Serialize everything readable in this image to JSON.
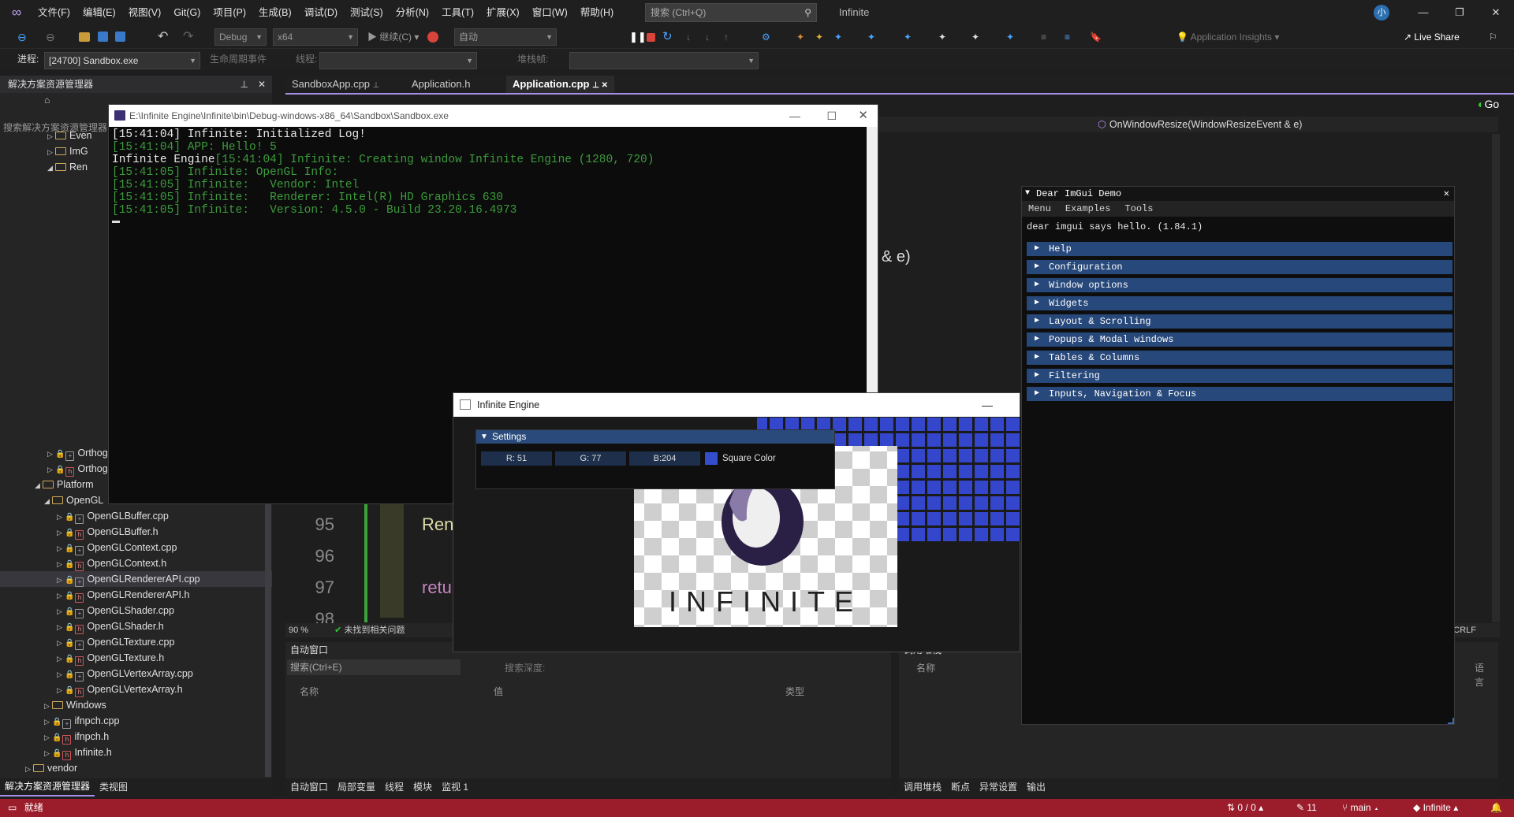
{
  "menu": [
    "文件(F)",
    "编辑(E)",
    "视图(V)",
    "Git(G)",
    "项目(P)",
    "生成(B)",
    "调试(D)",
    "测试(S)",
    "分析(N)",
    "工具(T)",
    "扩展(X)",
    "窗口(W)",
    "帮助(H)"
  ],
  "search": {
    "placeholder": "搜索 (Ctrl+Q)"
  },
  "solution_name": "Infinite",
  "account_initials": "小",
  "toolbar": {
    "config": "Debug",
    "platform": "x64",
    "continue": "继续(C)",
    "auto": "自动",
    "insights": "Application Insights",
    "live_share": "Live Share"
  },
  "toolbar2": {
    "process_label": "进程:",
    "process": "[24700] Sandbox.exe",
    "lifecycle": "生命周期事件",
    "thread_label": "线程:",
    "stack_label": "堆栈帧:"
  },
  "sol_explorer": {
    "title": "解决方案资源管理器",
    "search": "搜索解决方案资源管理器",
    "items": [
      {
        "label": "Even",
        "indent": 1
      },
      {
        "label": "ImG",
        "indent": 1
      },
      {
        "label": "Ren",
        "indent": 1
      },
      {
        "label": "OrthographicCamera.cpp",
        "indent": 1
      },
      {
        "label": "OrthographicCamera.h",
        "indent": 1
      },
      {
        "label": "Platform",
        "indent": 0
      },
      {
        "label": "OpenGL",
        "indent": 1
      },
      {
        "label": "OpenGLBuffer.cpp"
      },
      {
        "label": "OpenGLBuffer.h"
      },
      {
        "label": "OpenGLContext.cpp"
      },
      {
        "label": "OpenGLContext.h"
      },
      {
        "label": "OpenGLRendererAPI.cpp"
      },
      {
        "label": "OpenGLRendererAPI.h"
      },
      {
        "label": "OpenGLShader.cpp"
      },
      {
        "label": "OpenGLShader.h"
      },
      {
        "label": "OpenGLTexture.cpp"
      },
      {
        "label": "OpenGLTexture.h"
      },
      {
        "label": "OpenGLVertexArray.cpp"
      },
      {
        "label": "OpenGLVertexArray.h"
      },
      {
        "label": "Windows"
      },
      {
        "label": "ifnpch.cpp"
      },
      {
        "label": "ifnpch.h"
      },
      {
        "label": "Infinite.h"
      },
      {
        "label": "vendor"
      }
    ],
    "tabs": [
      "解决方案资源管理器",
      "类视图"
    ]
  },
  "doc_tabs": [
    "SandboxApp.cpp",
    "Application.h",
    "Application.cpp"
  ],
  "nav": {
    "member": "OnWindowResize(WindowResizeEvent & e)",
    "go": "Go"
  },
  "code": {
    "lines": [
      "95",
      "96",
      "97",
      "98"
    ],
    "line95": "Ren",
    "line97": "retu",
    "frag": "& e)"
  },
  "editor_status": {
    "zoom": "90 %",
    "issues": "未找到相关问题",
    "line_ending": "CRLF"
  },
  "autos": {
    "title": "自动窗口",
    "search": "搜索(Ctrl+E)",
    "depth": "搜索深度:",
    "col_name": "名称",
    "col_value": "值",
    "col_type": "类型",
    "tabs": [
      "自动窗口",
      "局部变量",
      "线程",
      "模块",
      "监视 1"
    ]
  },
  "callstack": {
    "title": "调用堆栈",
    "col_name": "名称",
    "col_lang": "语言",
    "tabs": [
      "调用堆栈",
      "断点",
      "异常设置",
      "输出"
    ]
  },
  "statusbar": {
    "ready": "就绪",
    "updown": "0 / 0",
    "pencil": "11",
    "branch": "main",
    "repo": "Infinite"
  },
  "console": {
    "title": "E:\\Infinite Engine\\Infinite\\bin\\Debug-windows-x86_64\\Sandbox\\Sandbox.exe",
    "lines": [
      {
        "text": "[15:41:04] Infinite: Initialized Log!",
        "color": "#e8e8e8"
      },
      {
        "text": "[15:41:04] APP: Hello! 5",
        "color": "#3c9a3c"
      },
      {
        "pre": "Infinite Engine",
        "text": "[15:41:04] Infinite: Creating window Infinite Engine (1280, 720)",
        "color": "#3c9a3c"
      },
      {
        "text": "[15:41:05] Infinite: OpenGL Info:",
        "color": "#3c9a3c"
      },
      {
        "text": "[15:41:05] Infinite:   Vendor: Intel",
        "color": "#3c9a3c"
      },
      {
        "text": "[15:41:05] Infinite:   Renderer: Intel(R) HD Graphics 630",
        "color": "#3c9a3c"
      },
      {
        "text": "[15:41:05] Infinite:   Version: 4.5.0 - Build 23.20.16.4973",
        "color": "#3c9a3c"
      }
    ]
  },
  "engine": {
    "title": "Infinite Engine",
    "settings": "Settings",
    "r": "R: 51",
    "g": "G: 77",
    "b": "B:204",
    "square_label": "Square Color",
    "logo_text": "INFINITE",
    "square_color": "#334dcc"
  },
  "imgui": {
    "title": "Dear ImGui Demo",
    "menu": [
      "Menu",
      "Examples",
      "Tools"
    ],
    "hello": "dear imgui says hello. (1.84.1)",
    "headers": [
      "Help",
      "Configuration",
      "Window options",
      "Widgets",
      "Layout & Scrolling",
      "Popups & Modal windows",
      "Tables & Columns",
      "Filtering",
      "Inputs, Navigation & Focus"
    ]
  }
}
